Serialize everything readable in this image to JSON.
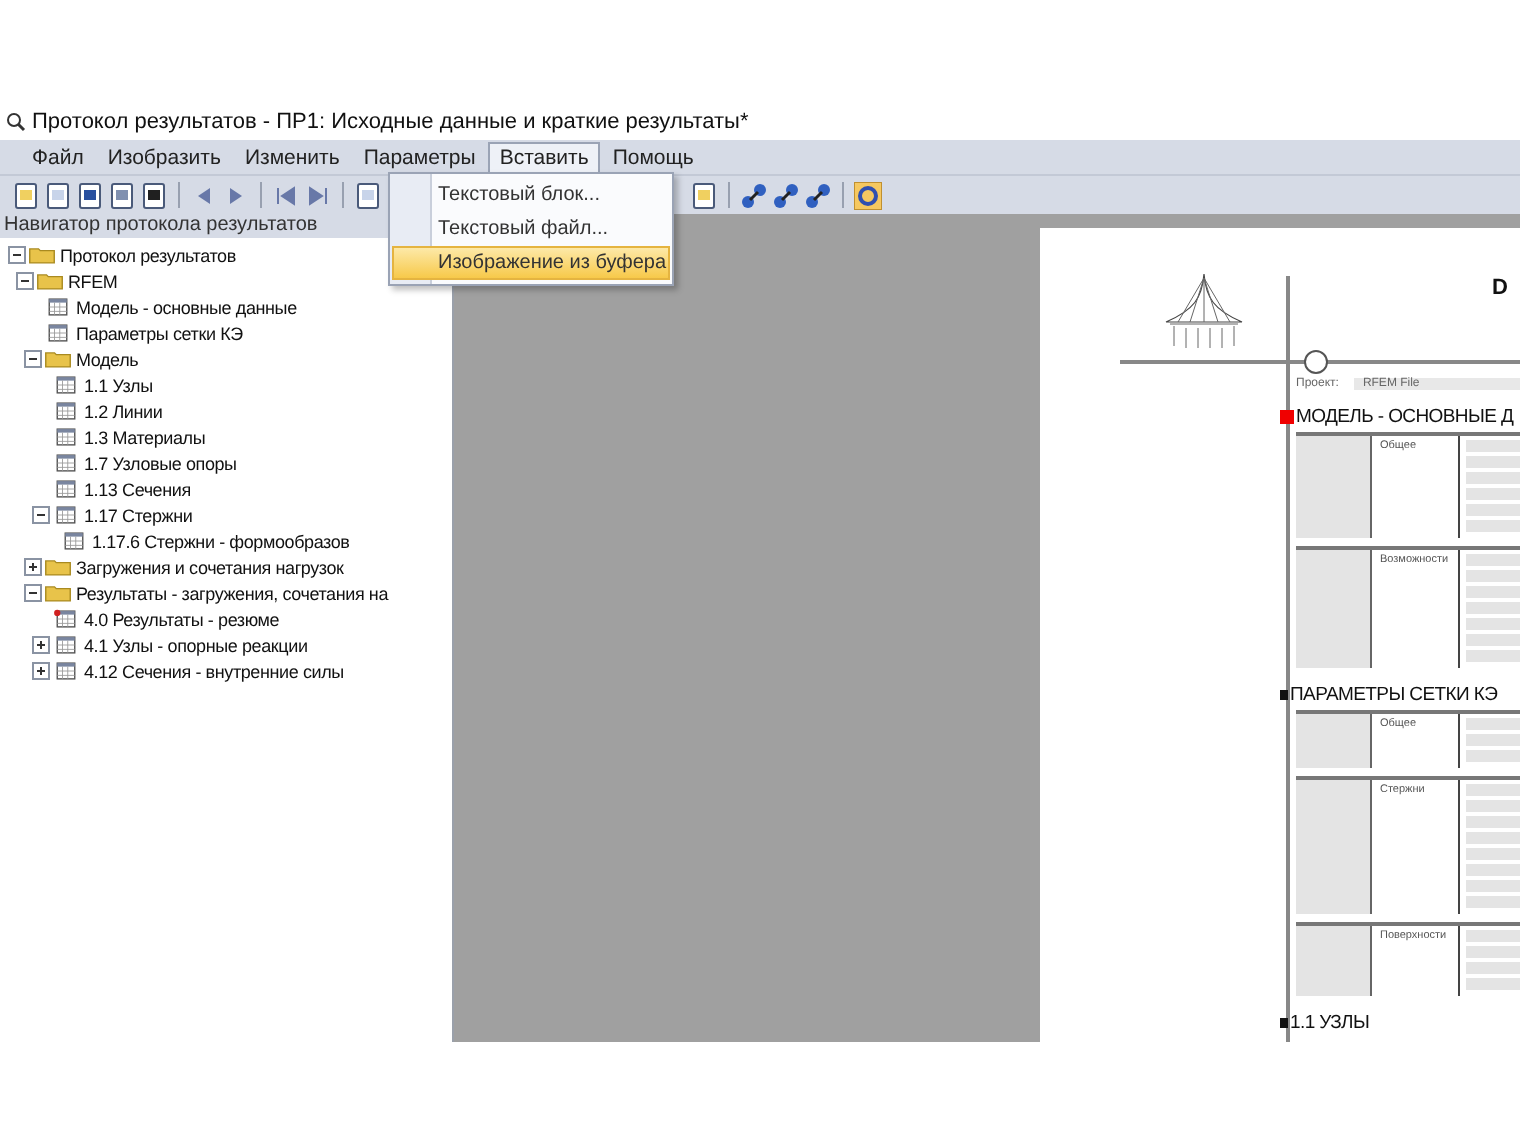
{
  "window": {
    "title": "Протокол результатов - ПР1: Исходные данные и краткие результаты*"
  },
  "menu": [
    {
      "label": "Файл",
      "selected": false
    },
    {
      "label": "Изобразить",
      "selected": false
    },
    {
      "label": "Изменить",
      "selected": false
    },
    {
      "label": "Параметры",
      "selected": false
    },
    {
      "label": "Вставить",
      "selected": true
    },
    {
      "label": "Помощь",
      "selected": false
    }
  ],
  "dropdown": [
    {
      "label": "Текстовый блок...",
      "selected": false
    },
    {
      "label": "Текстовый файл...",
      "selected": false
    },
    {
      "label": "Изображение из буфера",
      "selected": true
    }
  ],
  "navigator": {
    "title": "Навигатор протокола результатов",
    "tree": [
      {
        "label": "Протокол результатов",
        "kind": "folder",
        "expanded": true,
        "children": [
          {
            "label": "RFEM",
            "kind": "folder",
            "expanded": true,
            "children": [
              {
                "label": "Модель - основные данные",
                "kind": "table"
              },
              {
                "label": "Параметры сетки КЭ",
                "kind": "table"
              },
              {
                "label": "Модель",
                "kind": "folder",
                "expanded": true,
                "children": [
                  {
                    "label": "1.1 Узлы",
                    "kind": "table"
                  },
                  {
                    "label": "1.2 Линии",
                    "kind": "table"
                  },
                  {
                    "label": "1.3 Материалы",
                    "kind": "table"
                  },
                  {
                    "label": "1.7 Узловые опоры",
                    "kind": "table"
                  },
                  {
                    "label": "1.13 Сечения",
                    "kind": "table"
                  },
                  {
                    "label": "1.17 Стержни",
                    "kind": "table",
                    "expanded": true,
                    "children": [
                      {
                        "label": "1.17.6 Стержни - формообразов",
                        "kind": "table"
                      }
                    ]
                  }
                ]
              },
              {
                "label": "Загружения и сочетания нагрузок",
                "kind": "folder",
                "expanded": false
              },
              {
                "label": "Результаты - загружения, сочетания на",
                "kind": "folder",
                "expanded": true,
                "children": [
                  {
                    "label": "4.0 Результаты - резюме",
                    "kind": "pinned"
                  },
                  {
                    "label": "4.1 Узлы - опорные реакции",
                    "kind": "table",
                    "expanded": false
                  },
                  {
                    "label": "4.12 Сечения - внутренние силы",
                    "kind": "table",
                    "expanded": false
                  }
                ]
              }
            ]
          }
        ]
      }
    ]
  },
  "document": {
    "title_letter": "D",
    "project_label": "Проект:",
    "project_value": "RFEM File",
    "sections": [
      {
        "title": "МОДЕЛЬ - ОСНОВНЫЕ Д",
        "selected": true,
        "groups": [
          {
            "label": "Общее"
          },
          {
            "label": "Возможности"
          }
        ]
      },
      {
        "title": "ПАРАМЕТРЫ СЕТКИ КЭ",
        "selected": false,
        "groups": [
          {
            "label": "Общее"
          },
          {
            "label": "Стержни"
          },
          {
            "label": "Поверхности"
          }
        ]
      },
      {
        "title": "1.1 УЗЛЫ",
        "selected": false
      }
    ]
  }
}
